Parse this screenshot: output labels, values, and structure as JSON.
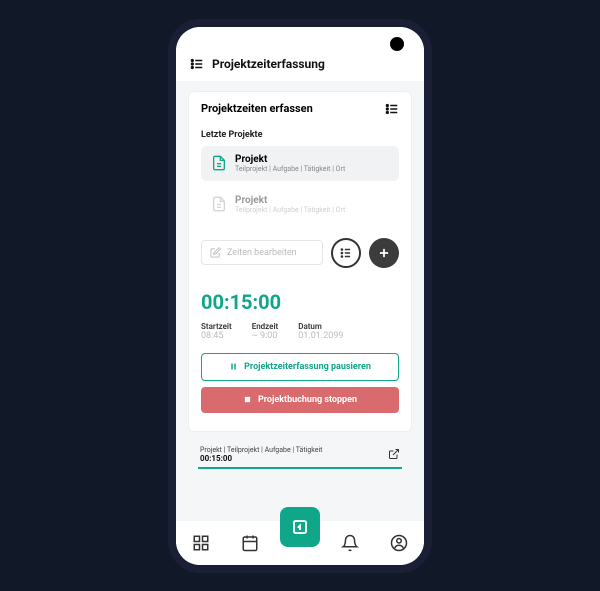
{
  "colors": {
    "accent": "#0fa68a",
    "danger": "#d96b6e"
  },
  "header": {
    "title": "Projektzeiterfassung"
  },
  "card": {
    "title": "Projektzeiten erfassen",
    "recent_label": "Letzte Projekte",
    "projects": [
      {
        "title": "Projekt",
        "sub": "Teilprojekt  |  Aufgabe  |  Tätigkeit  |  Ort"
      },
      {
        "title": "Projekt",
        "sub": "Teilprojekt  |  Aufgabe  |  Tätigkeit  |  Ort"
      }
    ],
    "edit_label": "Zeiten bearbeiten",
    "timer": "00:15:00",
    "meta": {
      "start_label": "Startzeit",
      "start_val": "08:45",
      "end_label": "Endzeit",
      "end_val": "~ 9:00",
      "date_label": "Datum",
      "date_val": "01.01.2099"
    },
    "pause_label": "Projektzeiterfassung pausieren",
    "stop_label": "Projektbuchung stoppen"
  },
  "footer": {
    "crumbs": "Projekt | Teilprojekt | Aufgabe | Tätigkeit",
    "time": "00:15:00"
  }
}
